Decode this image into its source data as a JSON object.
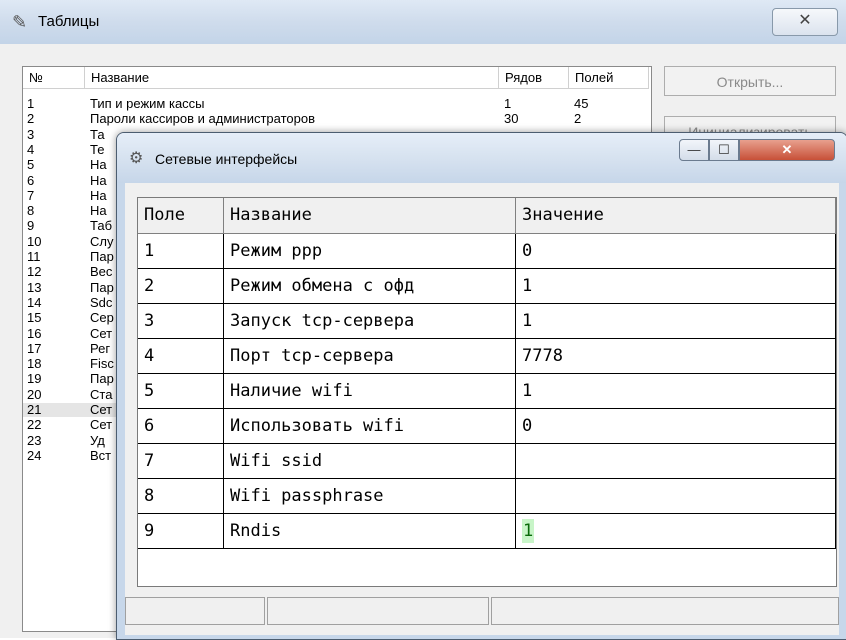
{
  "main": {
    "title": "Таблицы",
    "icon": "tables-icon",
    "close_glyph": "✕"
  },
  "tables": {
    "columns": [
      "№",
      "Название",
      "Рядов",
      "Полей"
    ],
    "rows": [
      {
        "n": "1",
        "name": "Тип и режим кассы",
        "rows": "1",
        "fields": "45"
      },
      {
        "n": "2",
        "name": "Пароли кассиров и администраторов",
        "rows": "30",
        "fields": "2"
      },
      {
        "n": "3",
        "name": "Та",
        "rows": "",
        "fields": ""
      },
      {
        "n": "4",
        "name": "Те",
        "rows": "",
        "fields": ""
      },
      {
        "n": "5",
        "name": "На",
        "rows": "",
        "fields": ""
      },
      {
        "n": "6",
        "name": "На",
        "rows": "",
        "fields": ""
      },
      {
        "n": "7",
        "name": "На",
        "rows": "",
        "fields": ""
      },
      {
        "n": "8",
        "name": "На",
        "rows": "",
        "fields": ""
      },
      {
        "n": "9",
        "name": "Таб",
        "rows": "",
        "fields": ""
      },
      {
        "n": "10",
        "name": "Слу",
        "rows": "",
        "fields": ""
      },
      {
        "n": "11",
        "name": "Пар",
        "rows": "",
        "fields": ""
      },
      {
        "n": "12",
        "name": "Вес",
        "rows": "",
        "fields": ""
      },
      {
        "n": "13",
        "name": "Пар",
        "rows": "",
        "fields": ""
      },
      {
        "n": "14",
        "name": "Sdc",
        "rows": "",
        "fields": ""
      },
      {
        "n": "15",
        "name": "Сер",
        "rows": "",
        "fields": ""
      },
      {
        "n": "16",
        "name": "Сет",
        "rows": "",
        "fields": ""
      },
      {
        "n": "17",
        "name": "Рег",
        "rows": "",
        "fields": ""
      },
      {
        "n": "18",
        "name": "Fisc",
        "rows": "",
        "fields": ""
      },
      {
        "n": "19",
        "name": "Пар",
        "rows": "",
        "fields": ""
      },
      {
        "n": "20",
        "name": "Ста",
        "rows": "",
        "fields": ""
      },
      {
        "n": "21",
        "name": "Сет",
        "rows": "",
        "fields": ""
      },
      {
        "n": "22",
        "name": "Сет",
        "rows": "",
        "fields": ""
      },
      {
        "n": "23",
        "name": "Уд",
        "rows": "",
        "fields": ""
      },
      {
        "n": "24",
        "name": "Вст",
        "rows": "",
        "fields": ""
      }
    ],
    "selected_index": 20
  },
  "buttons": {
    "open": "Открыть...",
    "init": "Инициализировать"
  },
  "dialog": {
    "title": "Сетевые интерфейсы",
    "icon": "network-icon",
    "min_glyph": "—",
    "max_glyph": "☐",
    "close_glyph": "✕",
    "columns": [
      "Поле",
      "Название",
      "Значение"
    ],
    "rows": [
      {
        "field": "1",
        "name": "Режим ppp",
        "value": "0"
      },
      {
        "field": "2",
        "name": "Режим обмена с офд",
        "value": "1"
      },
      {
        "field": "3",
        "name": "Запуск tcp-сервера",
        "value": "1"
      },
      {
        "field": "4",
        "name": "Порт tcp-сервера",
        "value": "7778"
      },
      {
        "field": "5",
        "name": "Наличие wifi",
        "value": "1"
      },
      {
        "field": "6",
        "name": "Использовать wifi",
        "value": "0"
      },
      {
        "field": "7",
        "name": "Wifi ssid",
        "value": ""
      },
      {
        "field": "8",
        "name": "Wifi passphrase",
        "value": ""
      },
      {
        "field": "9",
        "name": "Rndis",
        "value": "1"
      }
    ],
    "editing_row_index": 8
  }
}
